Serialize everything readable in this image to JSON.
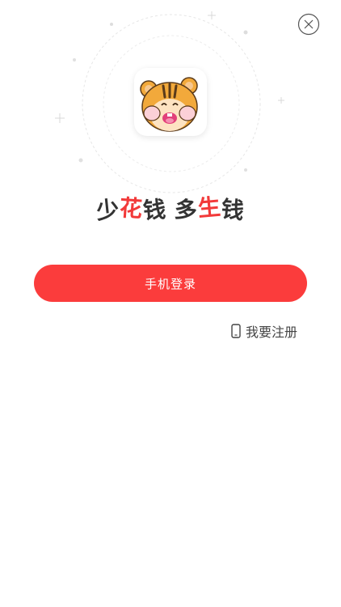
{
  "icons": {
    "close": "close-circle-icon",
    "logo": "hamster-mascot-icon",
    "phone": "phone-icon"
  },
  "colors": {
    "accent": "#fb3c3c",
    "background": "#ffffff"
  },
  "slogan": {
    "part1": "少",
    "part2": "花",
    "part3": "钱",
    "part4": "多",
    "part5": "生",
    "part6": "钱"
  },
  "login": {
    "button_label": "手机登录"
  },
  "register": {
    "label": "我要注册"
  }
}
